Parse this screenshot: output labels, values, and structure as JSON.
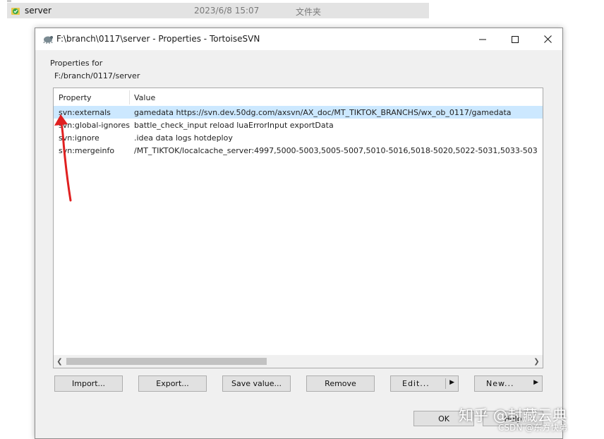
{
  "explorer": {
    "name": "server",
    "date": "2023/6/8 15:07",
    "type": "文件夹"
  },
  "dialog": {
    "title": "F:\\branch\\0117\\server - Properties - TortoiseSVN",
    "properties_for_label": "Properties for",
    "path": "F:/branch/0117/server"
  },
  "list": {
    "columns": [
      "Property",
      "Value"
    ],
    "rows": [
      {
        "property": "svn:externals",
        "value": "gamedata https://svn.dev.50dg.com/axsvn/AX_doc/MT_TIKTOK_BRANCHS/wx_ob_0117/gamedata",
        "selected": true
      },
      {
        "property": "svn:global-ignores",
        "value": "battle_check_input reload luaErrorInput exportData",
        "selected": false
      },
      {
        "property": "svn:ignore",
        "value": ".idea data logs hotdeploy",
        "selected": false
      },
      {
        "property": "svn:mergeinfo",
        "value": "/MT_TIKTOK/localcache_server:4997,5000-5003,5005-5007,5010-5016,5018-5020,5022-5031,5033-503",
        "selected": false
      }
    ]
  },
  "buttons": {
    "import": "Import...",
    "export": "Export...",
    "save_value": "Save value...",
    "remove": "Remove",
    "edit": "Edit...",
    "new": "New...",
    "ok": "OK",
    "help": "Help"
  },
  "watermark": {
    "main": "知乎 @封藏云典",
    "sub": "CSDN @东方快弟"
  },
  "colors": {
    "selection": "#cce8ff",
    "annotation_arrow": "#e02020",
    "dialog_bg": "#f0f0f0"
  }
}
